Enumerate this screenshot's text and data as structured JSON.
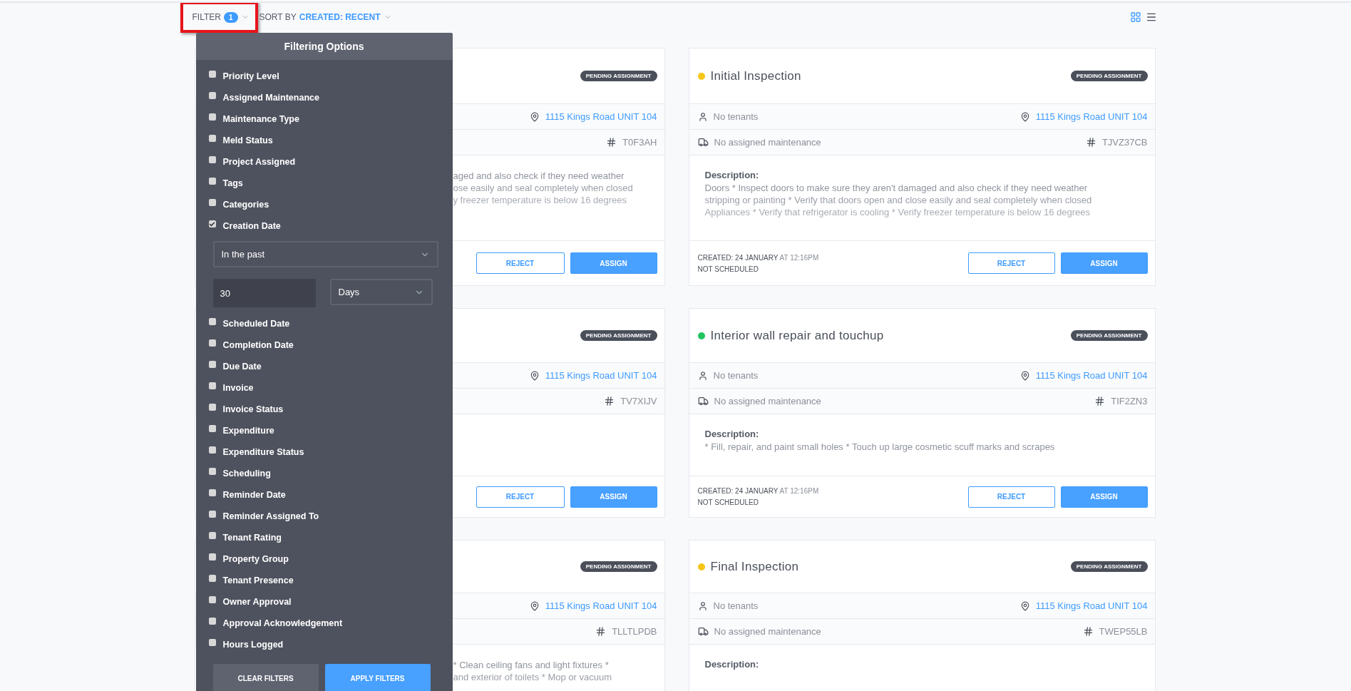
{
  "toolbar": {
    "filter": {
      "label": "FILTER",
      "count": "1",
      "highlighted": true
    },
    "sort": {
      "label": "SORT BY",
      "value": "CREATED: RECENT"
    },
    "views": [
      {
        "kind": "grid",
        "selected": true
      },
      {
        "kind": "list",
        "selected": false
      }
    ]
  },
  "filter_panel": {
    "title": "Filtering Options",
    "items": [
      {
        "label": "Priority Level",
        "checked": false
      },
      {
        "label": "Assigned Maintenance",
        "checked": false
      },
      {
        "label": "Maintenance Type",
        "checked": false
      },
      {
        "label": "Meld Status",
        "checked": false
      },
      {
        "label": "Project Assigned",
        "checked": false
      },
      {
        "label": "Tags",
        "checked": false
      },
      {
        "label": "Categories",
        "checked": false
      },
      {
        "label": "Creation Date",
        "checked": true,
        "range": {
          "mode": "In the past",
          "amount": "30",
          "unit": "Days"
        }
      },
      {
        "label": "Scheduled Date",
        "checked": false
      },
      {
        "label": "Completion Date",
        "checked": false
      },
      {
        "label": "Due Date",
        "checked": false
      },
      {
        "label": "Invoice",
        "checked": false
      },
      {
        "label": "Invoice Status",
        "checked": false
      },
      {
        "label": "Expenditure",
        "checked": false
      },
      {
        "label": "Expenditure Status",
        "checked": false
      },
      {
        "label": "Scheduling",
        "checked": false
      },
      {
        "label": "Reminder Date",
        "checked": false
      },
      {
        "label": "Reminder Assigned To",
        "checked": false
      },
      {
        "label": "Tenant Rating",
        "checked": false
      },
      {
        "label": "Property Group",
        "checked": false
      },
      {
        "label": "Tenant Presence",
        "checked": false
      },
      {
        "label": "Owner Approval",
        "checked": false
      },
      {
        "label": "Approval Acknowledgement",
        "checked": false
      },
      {
        "label": "Hours Logged",
        "checked": false
      }
    ],
    "buttons": {
      "clear": "CLEAR FILTERS",
      "apply": "APPLY FILTERS"
    }
  },
  "cards": [
    {
      "kind": "covered",
      "status": "PENDING ASSIGNMENT",
      "address": "1115 Kings Road UNIT 104",
      "code": "T0F3AH",
      "description_lines": [
        "aged and also check if they need weather",
        "ose easily and seal completely when closed",
        "y freezer temperature is below 16 degrees"
      ],
      "reject": "REJECT",
      "assign": "ASSIGN"
    },
    {
      "kind": "full",
      "title": "Initial Inspection",
      "color": "#f5c518",
      "status": "PENDING ASSIGNMENT",
      "tenants": "No tenants",
      "address": "1115 Kings Road UNIT 104",
      "maintenance": "No assigned maintenance",
      "code": "TJVZ37CB",
      "description_label": "Description:",
      "description_lines": [
        "Doors * Inspect doors to make sure they aren't damaged and also check if they need weather",
        "stripping or painting * Verify that doors open and close easily and seal completely when closed",
        "Appliances * Verify that refrigerator is cooling * Verify freezer temperature is below 16 degrees"
      ],
      "created": "CREATED: 24 JANUARY",
      "created_time": "AT 12:16PM",
      "schedule": "NOT SCHEDULED",
      "reject": "REJECT",
      "assign": "ASSIGN"
    },
    {
      "kind": "covered",
      "status": "PENDING ASSIGNMENT",
      "address": "1115 Kings Road UNIT 104",
      "code": "TV7XIJV",
      "reject": "REJECT",
      "assign": "ASSIGN"
    },
    {
      "kind": "full",
      "title": "Interior wall repair and touchup",
      "color": "#22c55e",
      "status": "PENDING ASSIGNMENT",
      "tenants": "No tenants",
      "address": "1115 Kings Road UNIT 104",
      "maintenance": "No assigned maintenance",
      "code": "TIF2ZN3",
      "description_label": "Description:",
      "description_lines": [
        "* Fill, repair, and paint small holes * Touch up large cosmetic scuff marks and scrapes"
      ],
      "created": "CREATED: 24 JANUARY",
      "created_time": "AT 12:16PM",
      "schedule": "NOT SCHEDULED",
      "reject": "REJECT",
      "assign": "ASSIGN"
    },
    {
      "kind": "covered",
      "status": "PENDING ASSIGNMENT",
      "address": "1115 Kings Road UNIT 104",
      "code": "TLLTLPDB",
      "description_lines": [
        "* Clean ceiling fans and light fixtures *",
        "and exterior of toilets * Mop or vacuum"
      ]
    },
    {
      "kind": "full",
      "title": "Final Inspection",
      "color": "#f5c518",
      "status": "PENDING ASSIGNMENT",
      "tenants": "No tenants",
      "address": "1115 Kings Road UNIT 104",
      "maintenance": "No assigned maintenance",
      "code": "TWEP55LB",
      "description_label": "Description:"
    }
  ]
}
